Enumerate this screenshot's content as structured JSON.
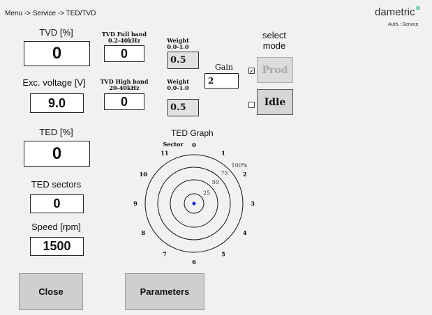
{
  "header": {
    "breadcrumb": "Menu -> Service -> TED/TVD",
    "brand": "dametric",
    "auth": "Auth.: Service"
  },
  "tvd": {
    "label": "TVD [%]",
    "value": "0"
  },
  "exc_voltage": {
    "label": "Exc. voltage [V]",
    "value": "9.0"
  },
  "ted": {
    "label": "TED [%]",
    "value": "0"
  },
  "ted_sectors": {
    "label": "TED sectors",
    "value": "0"
  },
  "speed": {
    "label": "Speed [rpm]",
    "value": "1500"
  },
  "tvd_full_band": {
    "label_line1": "TVD Full band",
    "label_line2": "0.2-40kHz",
    "value": "0"
  },
  "tvd_high_band": {
    "label_line1": "TVD High band",
    "label_line2": "20-40kHz",
    "value": "0"
  },
  "weight1": {
    "label_line1": "Weight",
    "label_line2": "0.0-1.0",
    "value": "0.5"
  },
  "weight2": {
    "label_line1": "Weight",
    "label_line2": "0.0-1.0",
    "value": "0.5"
  },
  "gain": {
    "label": "Gain",
    "value": "2"
  },
  "mode": {
    "title_line1": "select",
    "title_line2": "mode",
    "prod_label": "Prod",
    "idle_label": "Idle",
    "prod_checked": true,
    "idle_checked": false
  },
  "graph": {
    "title": "TED Graph",
    "sector_label": "Sector",
    "sectors": [
      "0",
      "1",
      "2",
      "3",
      "4",
      "5",
      "6",
      "7",
      "8",
      "9",
      "10",
      "11"
    ],
    "rings": [
      "25",
      "50",
      "75",
      "100%"
    ],
    "point": {
      "magnitude_pct": 0,
      "sector": 0
    }
  },
  "buttons": {
    "close": "Close",
    "parameters": "Parameters"
  },
  "colors": {
    "background": "#f1f1f1",
    "button": "#cfcfcf",
    "point": "#1a2ad6",
    "brand_accent": "#7fd0b0"
  }
}
